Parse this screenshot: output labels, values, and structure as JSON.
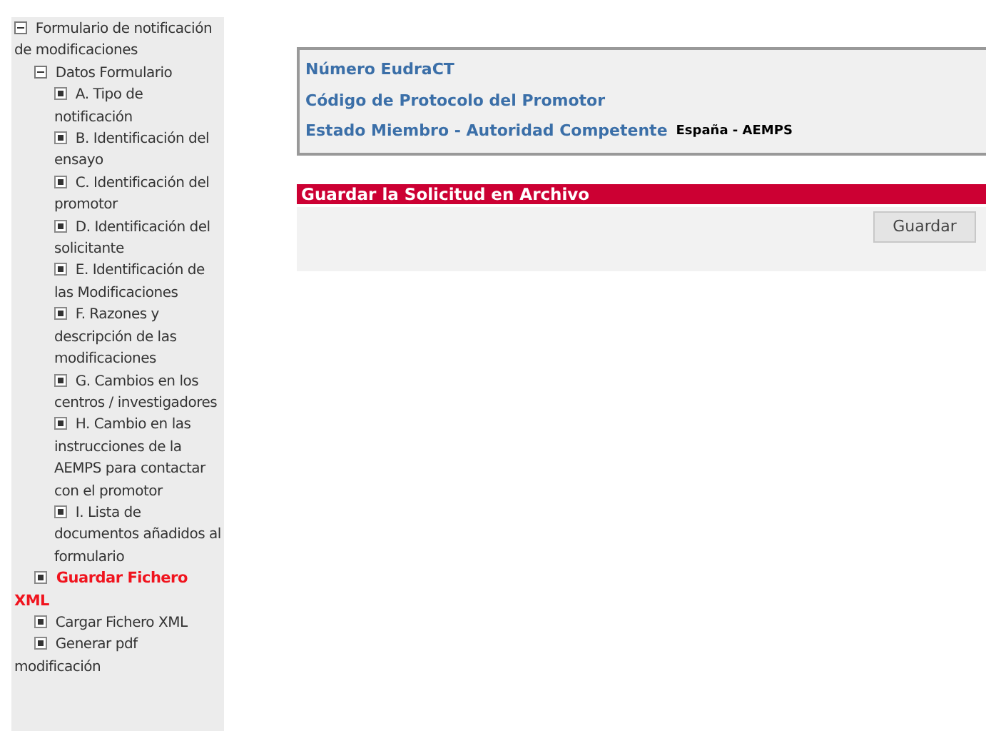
{
  "sidebar": {
    "tree": [
      {
        "label": "Formulario de notificación de modificaciones",
        "expanded": true,
        "selected": false,
        "children": [
          {
            "label": "Datos Formulario",
            "expanded": true,
            "selected": false,
            "children": [
              {
                "label": "A. Tipo de notificación",
                "selected": false
              },
              {
                "label": "B. Identificación del ensayo",
                "selected": false
              },
              {
                "label": "C. Identificación del promotor",
                "selected": false
              },
              {
                "label": "D. Identificación del solicitante",
                "selected": false
              },
              {
                "label": "E. Identificación de las Modificaciones",
                "selected": false
              },
              {
                "label": "F. Razones y descripción de las modificaciones",
                "selected": false
              },
              {
                "label": "G. Cambios en los centros / investigadores",
                "selected": false
              },
              {
                "label": "H. Cambio en las instrucciones de la AEMPS para contactar con el promotor",
                "selected": false
              },
              {
                "label": "I. Lista de documentos añadidos al formulario",
                "selected": false
              }
            ]
          },
          {
            "label": "Guardar Fichero XML",
            "selected": true
          },
          {
            "label": "Cargar Fichero XML",
            "selected": false
          },
          {
            "label": "Generar pdf modificación",
            "selected": false
          }
        ]
      }
    ]
  },
  "info": {
    "fields": [
      {
        "label": "Número EudraCT"
      },
      {
        "label": "Código de Protocolo del Promotor"
      },
      {
        "label": "Estado Miembro - Autoridad Competente",
        "value": "España - AEMPS"
      }
    ]
  },
  "save_section": {
    "title": "Guardar la Solicitud en Archivo",
    "button": "Guardar"
  }
}
